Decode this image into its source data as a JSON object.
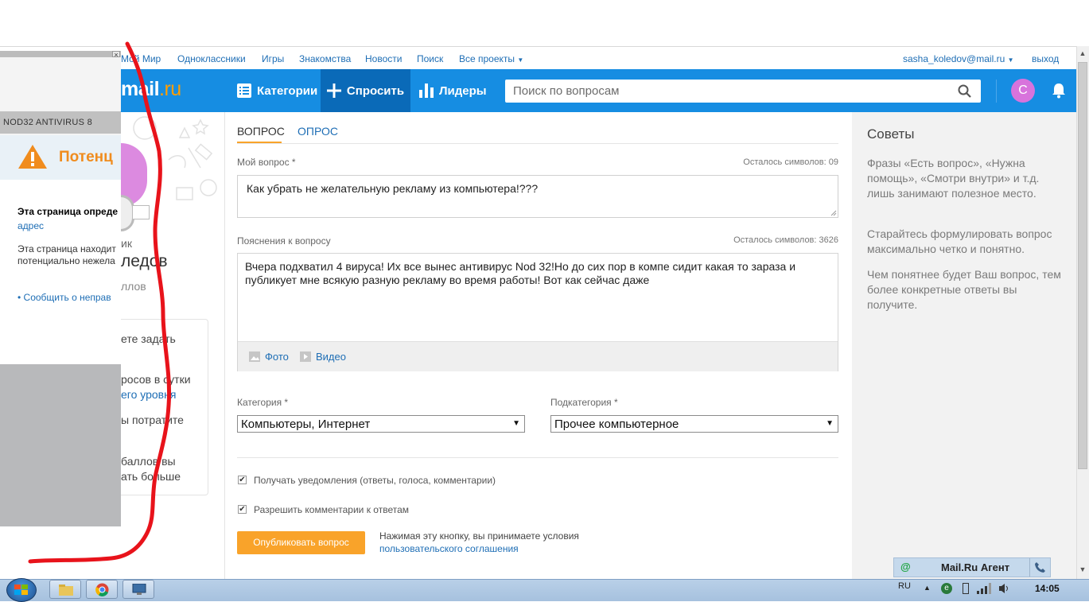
{
  "portal": {
    "links": [
      "Мой Мир",
      "Одноклассники",
      "Игры",
      "Знакомства",
      "Новости",
      "Поиск",
      "Все проекты"
    ],
    "user": "sasha_koledov@mail.ru",
    "logout": "выход"
  },
  "header": {
    "logo": "mail",
    "logo_suffix": ".ru",
    "categories": "Категории",
    "ask": "Спросить",
    "leaders": "Лидеры",
    "search_placeholder": "Поиск по вопросам",
    "avatar_letter": "С"
  },
  "left_popup": {
    "title_text": "NOD32 ANTIVIRUS 8",
    "close": "×",
    "warning_title": "Потенц",
    "heading": "Эта страница опреде",
    "address_link": "адрес",
    "body_line1": "Эта страница находит",
    "body_line2": "потенциально нежела",
    "report_link": "• Сообщить о неправ"
  },
  "left_column": {
    "role_fragment": "ик",
    "name_fragment": "ледов",
    "points_fragment": "ллов",
    "line1": "ете задать",
    "line2": "росов в сутки",
    "line3": "его уровня",
    "line4": "ы потратите",
    "line5": "баллов вы",
    "line6": "ать больше"
  },
  "form": {
    "tab_question": "ВОПРОС",
    "tab_poll": "ОПРОС",
    "question_label": "Мой вопрос *",
    "question_counter": "Осталось символов: 09",
    "question_value": "Как убрать не желательную рекламу из компьютера!???",
    "explain_label": "Пояснения к вопросу",
    "explain_counter": "Осталось символов: 3626",
    "explain_value": "Вчера подхватил 4 вируса! Их все вынес антивирус Nod 32!Но до сих пор в компе сидит какая то зараза и публикует мне всякую разную рекламу во время работы! Вот как сейчас даже",
    "photo": "Фото",
    "video": "Видео",
    "category_label": "Категория *",
    "category_value": "Компьютеры, Интернет",
    "subcategory_label": "Подкатегория *",
    "subcategory_value": "Прочее компьютерное",
    "notify_label": "Получать уведомления (ответы, голоса, комментарии)",
    "comments_label": "Разрешить комментарии к ответам",
    "publish": "Опубликовать вопрос",
    "terms_text": "Нажимая эту кнопку, вы принимаете условия",
    "terms_link": "пользовательского соглашения"
  },
  "tips": {
    "title": "Советы",
    "tip1": "Фразы «Есть вопрос», «Нужна помощь», «Смотри внутри» и т.д. лишь занимают полезное место.",
    "tip2": "Старайтесь формулировать вопрос максимально четко и понятно.",
    "tip3": "Чем понятнее будет Ваш вопрос, тем более конкретные ответы вы получите."
  },
  "agent": {
    "icon": "@",
    "label": "Mail.Ru Агент"
  },
  "taskbar": {
    "lang": "RU",
    "time": "14:05"
  },
  "colors": {
    "header_blue": "#168de2",
    "ask_blue": "#0a6ab8",
    "publish_orange": "#f9a32a",
    "link_blue": "#1e6eb5",
    "annotation_red": "#e8131b"
  }
}
